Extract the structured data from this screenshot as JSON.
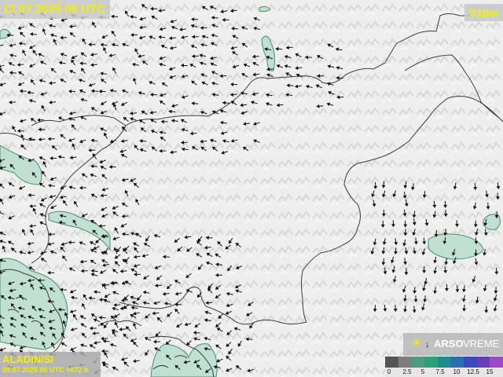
{
  "map": {
    "valid_time": "12.07.2025 00 UTC",
    "parameter": "V10m",
    "model": "ALADIN/SI",
    "run_info": "09.07.2025 00 UTC +072 h",
    "brand": {
      "icon": "sun-icon",
      "name": "ARSO",
      "subtitle": "VREME"
    },
    "legend": {
      "labels": [
        "0",
        "2.5",
        "5",
        "7.5",
        "10",
        "12.5",
        "15"
      ],
      "colors": [
        "#555555",
        "#7d7d7d",
        "#4f9a83",
        "#2f9f78",
        "#1e8c8c",
        "#2a6fae",
        "#3b49bd",
        "#6a3cb8",
        "#9c4bc2"
      ]
    },
    "colors": {
      "label_text": "#f4f000",
      "land": "#ececec",
      "strong_wind": "#bfe0d2"
    }
  }
}
